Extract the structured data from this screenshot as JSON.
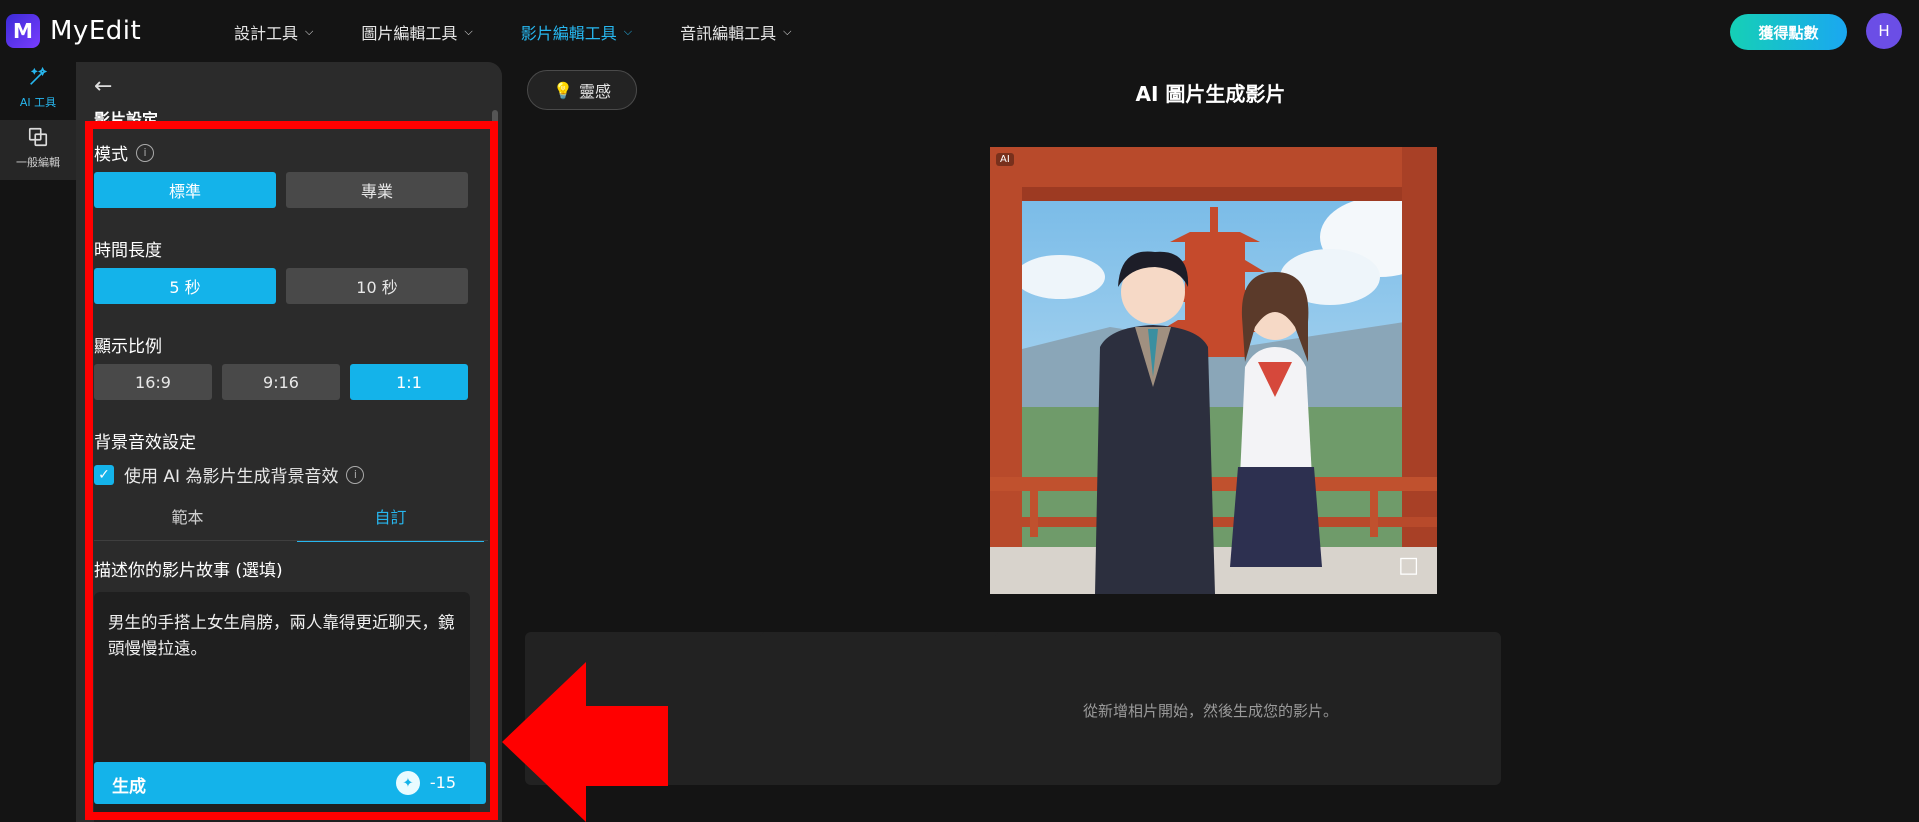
{
  "app": {
    "name": "MyEdit",
    "logo_letter": "M",
    "accent_color": "#14b3ea",
    "annotation_color": "#ff0000"
  },
  "nav": {
    "items": [
      {
        "label": "設計工具",
        "active": false
      },
      {
        "label": "圖片編輯工具",
        "active": false
      },
      {
        "label": "影片編輯工具",
        "active": true
      },
      {
        "label": "音訊編輯工具",
        "active": false
      }
    ],
    "get_points": "獲得點數",
    "avatar_initial": "H"
  },
  "rail": {
    "items": [
      {
        "label": "AI 工具",
        "icon": "magic-wand-icon",
        "active": true
      },
      {
        "label": "一般編輯",
        "icon": "copy-layers-icon",
        "active": false
      }
    ]
  },
  "panel": {
    "title": "影片設定",
    "mode": {
      "label": "模式",
      "options": [
        "標準",
        "專業"
      ],
      "selected": "標準"
    },
    "duration": {
      "label": "時間長度",
      "options": [
        "5 秒",
        "10 秒"
      ],
      "selected": "5 秒"
    },
    "ratio": {
      "label": "顯示比例",
      "options": [
        "16:9",
        "9:16",
        "1:1"
      ],
      "selected": "1:1"
    },
    "audio": {
      "label": "背景音效設定",
      "checkbox_label": "使用 AI 為影片生成背景音效",
      "checked": true,
      "tabs": [
        "範本",
        "自訂"
      ],
      "active_tab": "自訂"
    },
    "story": {
      "label": "描述你的影片故事 (選填)",
      "value": "男生的手搭上女生肩膀，兩人靠得更近聊天，鏡頭慢慢拉遠。"
    },
    "generate": {
      "label": "生成",
      "cost": "-15",
      "icon": "credit-shield-icon"
    }
  },
  "main": {
    "inspiration_label": "靈感",
    "title": "AI 圖片生成影片",
    "ai_badge": "AI",
    "crop_icon": "crop-icon",
    "hint": "從新增相片開始，然後生成您的影片。"
  }
}
